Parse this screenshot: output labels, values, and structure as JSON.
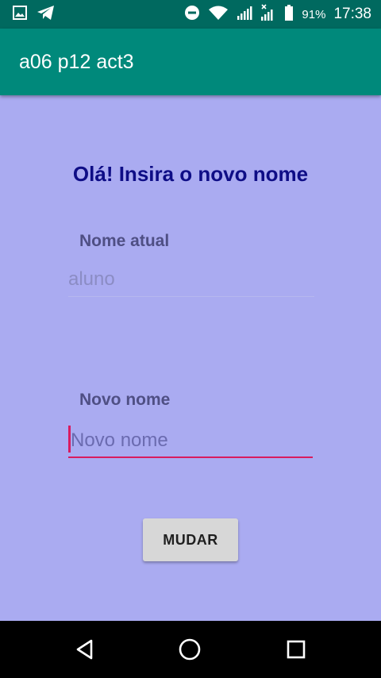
{
  "status_bar": {
    "battery_percent": "91%",
    "time": "17:38",
    "icons": [
      "image-icon",
      "telegram-icon",
      "do-not-disturb-icon",
      "wifi-icon",
      "signal-icon",
      "signal-no-data-icon",
      "battery-icon"
    ]
  },
  "app_bar": {
    "title": "a06 p12 act3"
  },
  "main": {
    "greeting": "Olá! Insira o novo nome",
    "current_name_label": "Nome atual",
    "current_name_value": "aluno",
    "new_name_label": "Novo nome",
    "new_name_placeholder": "Novo nome",
    "new_name_value": "",
    "button_label": "MUDAR"
  },
  "nav_bar": {
    "buttons": [
      "back-icon",
      "home-icon",
      "recents-icon"
    ]
  },
  "colors": {
    "status_bar": "#00695f",
    "app_bar": "#00897b",
    "background": "#aaabf1",
    "greeting": "#0e0d86",
    "accent": "#d81b60"
  }
}
